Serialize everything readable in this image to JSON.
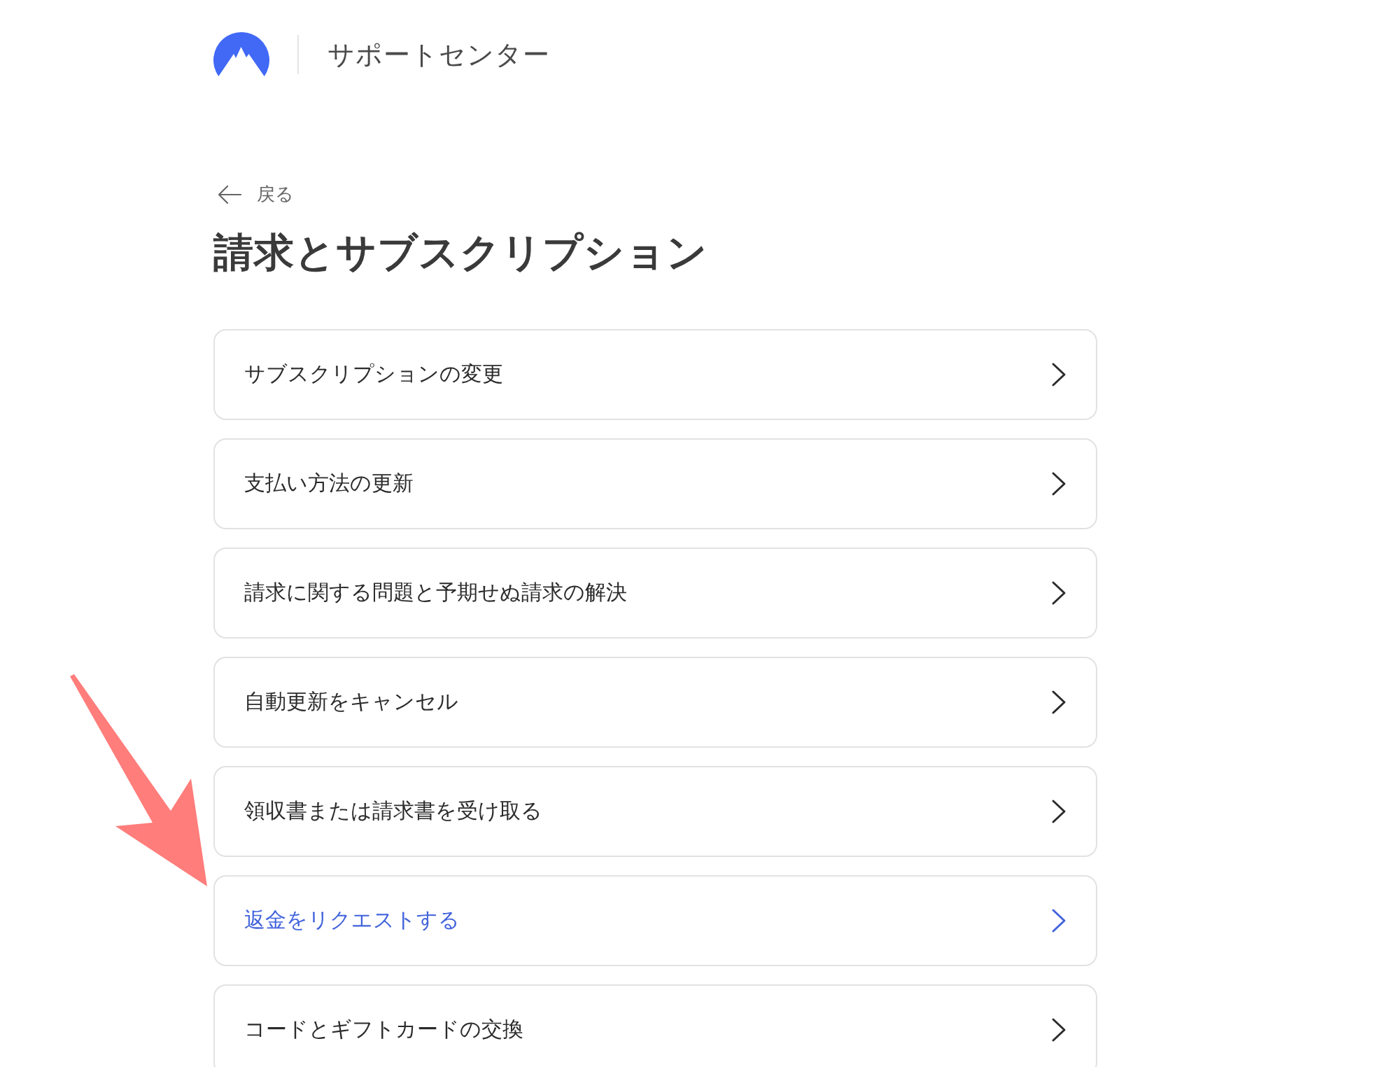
{
  "header": {
    "title": "サポートセンター"
  },
  "back_link": {
    "label": "戻る"
  },
  "page_title": "請求とサブスクリプション",
  "items": [
    {
      "label": "サブスクリプションの変更",
      "highlighted": false
    },
    {
      "label": "支払い方法の更新",
      "highlighted": false
    },
    {
      "label": "請求に関する問題と予期せぬ請求の解決",
      "highlighted": false
    },
    {
      "label": "自動更新をキャンセル",
      "highlighted": false
    },
    {
      "label": "領収書または請求書を受け取る",
      "highlighted": false
    },
    {
      "label": "返金をリクエストする",
      "highlighted": true
    },
    {
      "label": "コードとギフトカードの交換",
      "highlighted": false
    }
  ]
}
